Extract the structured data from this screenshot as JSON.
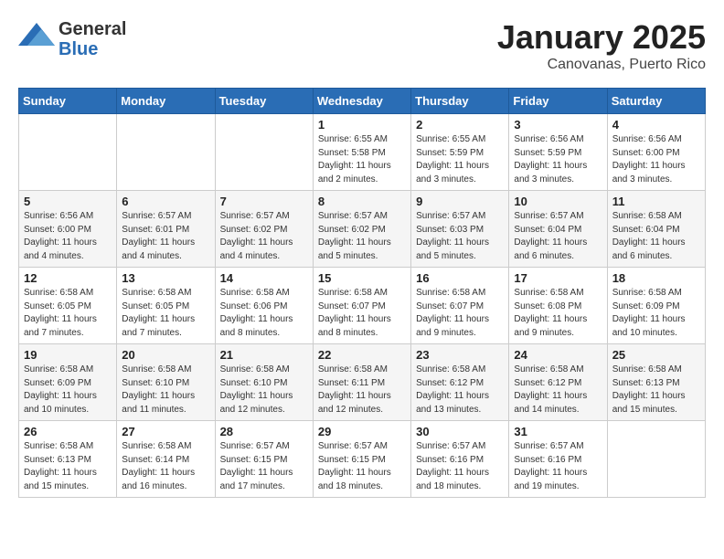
{
  "header": {
    "logo_general": "General",
    "logo_blue": "Blue",
    "title": "January 2025",
    "subtitle": "Canovanas, Puerto Rico"
  },
  "days_of_week": [
    "Sunday",
    "Monday",
    "Tuesday",
    "Wednesday",
    "Thursday",
    "Friday",
    "Saturday"
  ],
  "weeks": [
    [
      {
        "day": "",
        "sunrise": "",
        "sunset": "",
        "daylight": ""
      },
      {
        "day": "",
        "sunrise": "",
        "sunset": "",
        "daylight": ""
      },
      {
        "day": "",
        "sunrise": "",
        "sunset": "",
        "daylight": ""
      },
      {
        "day": "1",
        "sunrise": "Sunrise: 6:55 AM",
        "sunset": "Sunset: 5:58 PM",
        "daylight": "Daylight: 11 hours and 2 minutes."
      },
      {
        "day": "2",
        "sunrise": "Sunrise: 6:55 AM",
        "sunset": "Sunset: 5:59 PM",
        "daylight": "Daylight: 11 hours and 3 minutes."
      },
      {
        "day": "3",
        "sunrise": "Sunrise: 6:56 AM",
        "sunset": "Sunset: 5:59 PM",
        "daylight": "Daylight: 11 hours and 3 minutes."
      },
      {
        "day": "4",
        "sunrise": "Sunrise: 6:56 AM",
        "sunset": "Sunset: 6:00 PM",
        "daylight": "Daylight: 11 hours and 3 minutes."
      }
    ],
    [
      {
        "day": "5",
        "sunrise": "Sunrise: 6:56 AM",
        "sunset": "Sunset: 6:00 PM",
        "daylight": "Daylight: 11 hours and 4 minutes."
      },
      {
        "day": "6",
        "sunrise": "Sunrise: 6:57 AM",
        "sunset": "Sunset: 6:01 PM",
        "daylight": "Daylight: 11 hours and 4 minutes."
      },
      {
        "day": "7",
        "sunrise": "Sunrise: 6:57 AM",
        "sunset": "Sunset: 6:02 PM",
        "daylight": "Daylight: 11 hours and 4 minutes."
      },
      {
        "day": "8",
        "sunrise": "Sunrise: 6:57 AM",
        "sunset": "Sunset: 6:02 PM",
        "daylight": "Daylight: 11 hours and 5 minutes."
      },
      {
        "day": "9",
        "sunrise": "Sunrise: 6:57 AM",
        "sunset": "Sunset: 6:03 PM",
        "daylight": "Daylight: 11 hours and 5 minutes."
      },
      {
        "day": "10",
        "sunrise": "Sunrise: 6:57 AM",
        "sunset": "Sunset: 6:04 PM",
        "daylight": "Daylight: 11 hours and 6 minutes."
      },
      {
        "day": "11",
        "sunrise": "Sunrise: 6:58 AM",
        "sunset": "Sunset: 6:04 PM",
        "daylight": "Daylight: 11 hours and 6 minutes."
      }
    ],
    [
      {
        "day": "12",
        "sunrise": "Sunrise: 6:58 AM",
        "sunset": "Sunset: 6:05 PM",
        "daylight": "Daylight: 11 hours and 7 minutes."
      },
      {
        "day": "13",
        "sunrise": "Sunrise: 6:58 AM",
        "sunset": "Sunset: 6:05 PM",
        "daylight": "Daylight: 11 hours and 7 minutes."
      },
      {
        "day": "14",
        "sunrise": "Sunrise: 6:58 AM",
        "sunset": "Sunset: 6:06 PM",
        "daylight": "Daylight: 11 hours and 8 minutes."
      },
      {
        "day": "15",
        "sunrise": "Sunrise: 6:58 AM",
        "sunset": "Sunset: 6:07 PM",
        "daylight": "Daylight: 11 hours and 8 minutes."
      },
      {
        "day": "16",
        "sunrise": "Sunrise: 6:58 AM",
        "sunset": "Sunset: 6:07 PM",
        "daylight": "Daylight: 11 hours and 9 minutes."
      },
      {
        "day": "17",
        "sunrise": "Sunrise: 6:58 AM",
        "sunset": "Sunset: 6:08 PM",
        "daylight": "Daylight: 11 hours and 9 minutes."
      },
      {
        "day": "18",
        "sunrise": "Sunrise: 6:58 AM",
        "sunset": "Sunset: 6:09 PM",
        "daylight": "Daylight: 11 hours and 10 minutes."
      }
    ],
    [
      {
        "day": "19",
        "sunrise": "Sunrise: 6:58 AM",
        "sunset": "Sunset: 6:09 PM",
        "daylight": "Daylight: 11 hours and 10 minutes."
      },
      {
        "day": "20",
        "sunrise": "Sunrise: 6:58 AM",
        "sunset": "Sunset: 6:10 PM",
        "daylight": "Daylight: 11 hours and 11 minutes."
      },
      {
        "day": "21",
        "sunrise": "Sunrise: 6:58 AM",
        "sunset": "Sunset: 6:10 PM",
        "daylight": "Daylight: 11 hours and 12 minutes."
      },
      {
        "day": "22",
        "sunrise": "Sunrise: 6:58 AM",
        "sunset": "Sunset: 6:11 PM",
        "daylight": "Daylight: 11 hours and 12 minutes."
      },
      {
        "day": "23",
        "sunrise": "Sunrise: 6:58 AM",
        "sunset": "Sunset: 6:12 PM",
        "daylight": "Daylight: 11 hours and 13 minutes."
      },
      {
        "day": "24",
        "sunrise": "Sunrise: 6:58 AM",
        "sunset": "Sunset: 6:12 PM",
        "daylight": "Daylight: 11 hours and 14 minutes."
      },
      {
        "day": "25",
        "sunrise": "Sunrise: 6:58 AM",
        "sunset": "Sunset: 6:13 PM",
        "daylight": "Daylight: 11 hours and 15 minutes."
      }
    ],
    [
      {
        "day": "26",
        "sunrise": "Sunrise: 6:58 AM",
        "sunset": "Sunset: 6:13 PM",
        "daylight": "Daylight: 11 hours and 15 minutes."
      },
      {
        "day": "27",
        "sunrise": "Sunrise: 6:58 AM",
        "sunset": "Sunset: 6:14 PM",
        "daylight": "Daylight: 11 hours and 16 minutes."
      },
      {
        "day": "28",
        "sunrise": "Sunrise: 6:57 AM",
        "sunset": "Sunset: 6:15 PM",
        "daylight": "Daylight: 11 hours and 17 minutes."
      },
      {
        "day": "29",
        "sunrise": "Sunrise: 6:57 AM",
        "sunset": "Sunset: 6:15 PM",
        "daylight": "Daylight: 11 hours and 18 minutes."
      },
      {
        "day": "30",
        "sunrise": "Sunrise: 6:57 AM",
        "sunset": "Sunset: 6:16 PM",
        "daylight": "Daylight: 11 hours and 18 minutes."
      },
      {
        "day": "31",
        "sunrise": "Sunrise: 6:57 AM",
        "sunset": "Sunset: 6:16 PM",
        "daylight": "Daylight: 11 hours and 19 minutes."
      },
      {
        "day": "",
        "sunrise": "",
        "sunset": "",
        "daylight": ""
      }
    ]
  ]
}
